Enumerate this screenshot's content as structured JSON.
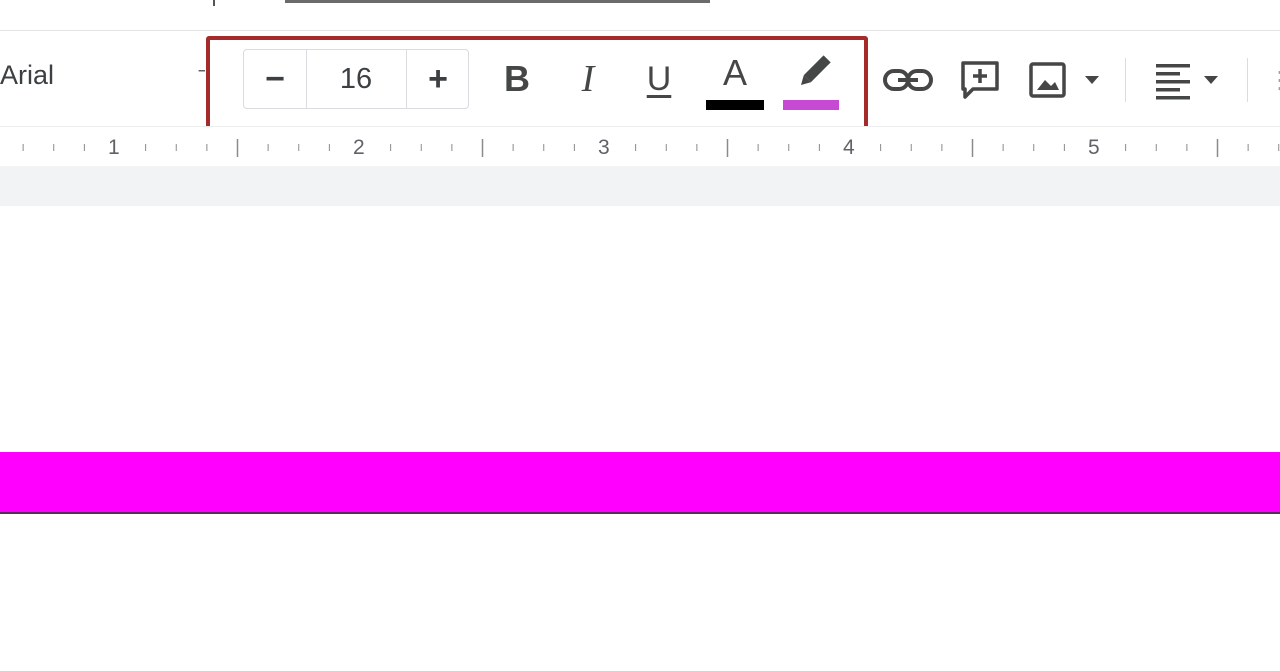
{
  "toolbar": {
    "font_family": "Arial",
    "font_size": "16",
    "decrease_label": "−",
    "increase_label": "+",
    "bold_label": "B",
    "italic_label": "I",
    "underline_label": "U",
    "text_color_label": "A",
    "text_color": "#000000",
    "highlight_color": "#c64ad3",
    "icons": [
      "pencil-icon",
      "link-icon",
      "add-comment-icon",
      "image-icon",
      "align-left-icon",
      "dropdown-arrow-icon"
    ]
  },
  "ruler": {
    "labels": [
      "1",
      "2",
      "3",
      "4",
      "5"
    ]
  },
  "document": {
    "highlight_fill": "#ff00ff"
  },
  "annotation": {
    "frame_color": "#a52a2a"
  }
}
